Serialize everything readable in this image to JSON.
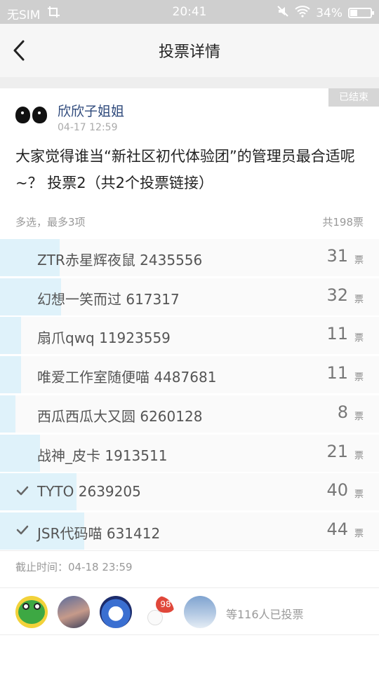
{
  "status_bar": {
    "carrier": "无SIM",
    "time": "20:41",
    "battery": "34%",
    "battery_level": 0.34,
    "icons": [
      "screenshot-icon",
      "mute-icon",
      "wifi-icon",
      "battery-icon"
    ]
  },
  "nav": {
    "back_icon": "chevron-left-icon",
    "title": "投票详情"
  },
  "post": {
    "status_tag": "已结束",
    "author_name": "欣欣子姐姐",
    "timestamp": "04-17 12:59",
    "title": "大家觉得谁当“新社区初代体验团”的管理员最合适呢~？ 投票2（共2个投票链接）"
  },
  "vote_meta": {
    "rule": "多选，最多3项",
    "total": "共198票"
  },
  "options": [
    {
      "label": "ZTR赤星辉夜鼠 2435556",
      "count": "31",
      "unit": "票",
      "share": 0.157,
      "selected": false
    },
    {
      "label": "幻想一笑而过 617317",
      "count": "32",
      "unit": "票",
      "share": 0.162,
      "selected": false
    },
    {
      "label": "扇爪qwq 11923559",
      "count": "11",
      "unit": "票",
      "share": 0.056,
      "selected": false
    },
    {
      "label": "唯爱工作室随便喵 4487681",
      "count": "11",
      "unit": "票",
      "share": 0.056,
      "selected": false
    },
    {
      "label": "西瓜西瓜大又圆 6260128",
      "count": "8",
      "unit": "票",
      "share": 0.04,
      "selected": false
    },
    {
      "label": "战神_皮卡 1913511",
      "count": "21",
      "unit": "票",
      "share": 0.106,
      "selected": false
    },
    {
      "label": "TYTO 2639205",
      "count": "40",
      "unit": "票",
      "share": 0.202,
      "selected": true
    },
    {
      "label": "JSR代码喵 631412",
      "count": "44",
      "unit": "票",
      "share": 0.222,
      "selected": true
    }
  ],
  "deadline": {
    "label": "截止时间：",
    "value": "04-18 23:59"
  },
  "voters": {
    "badge_count": "98",
    "summary": "等116人已投票"
  },
  "colors": {
    "bar_fill": "#dff2fa",
    "author_name": "#2f4a7c",
    "badge": "#e0473a"
  }
}
